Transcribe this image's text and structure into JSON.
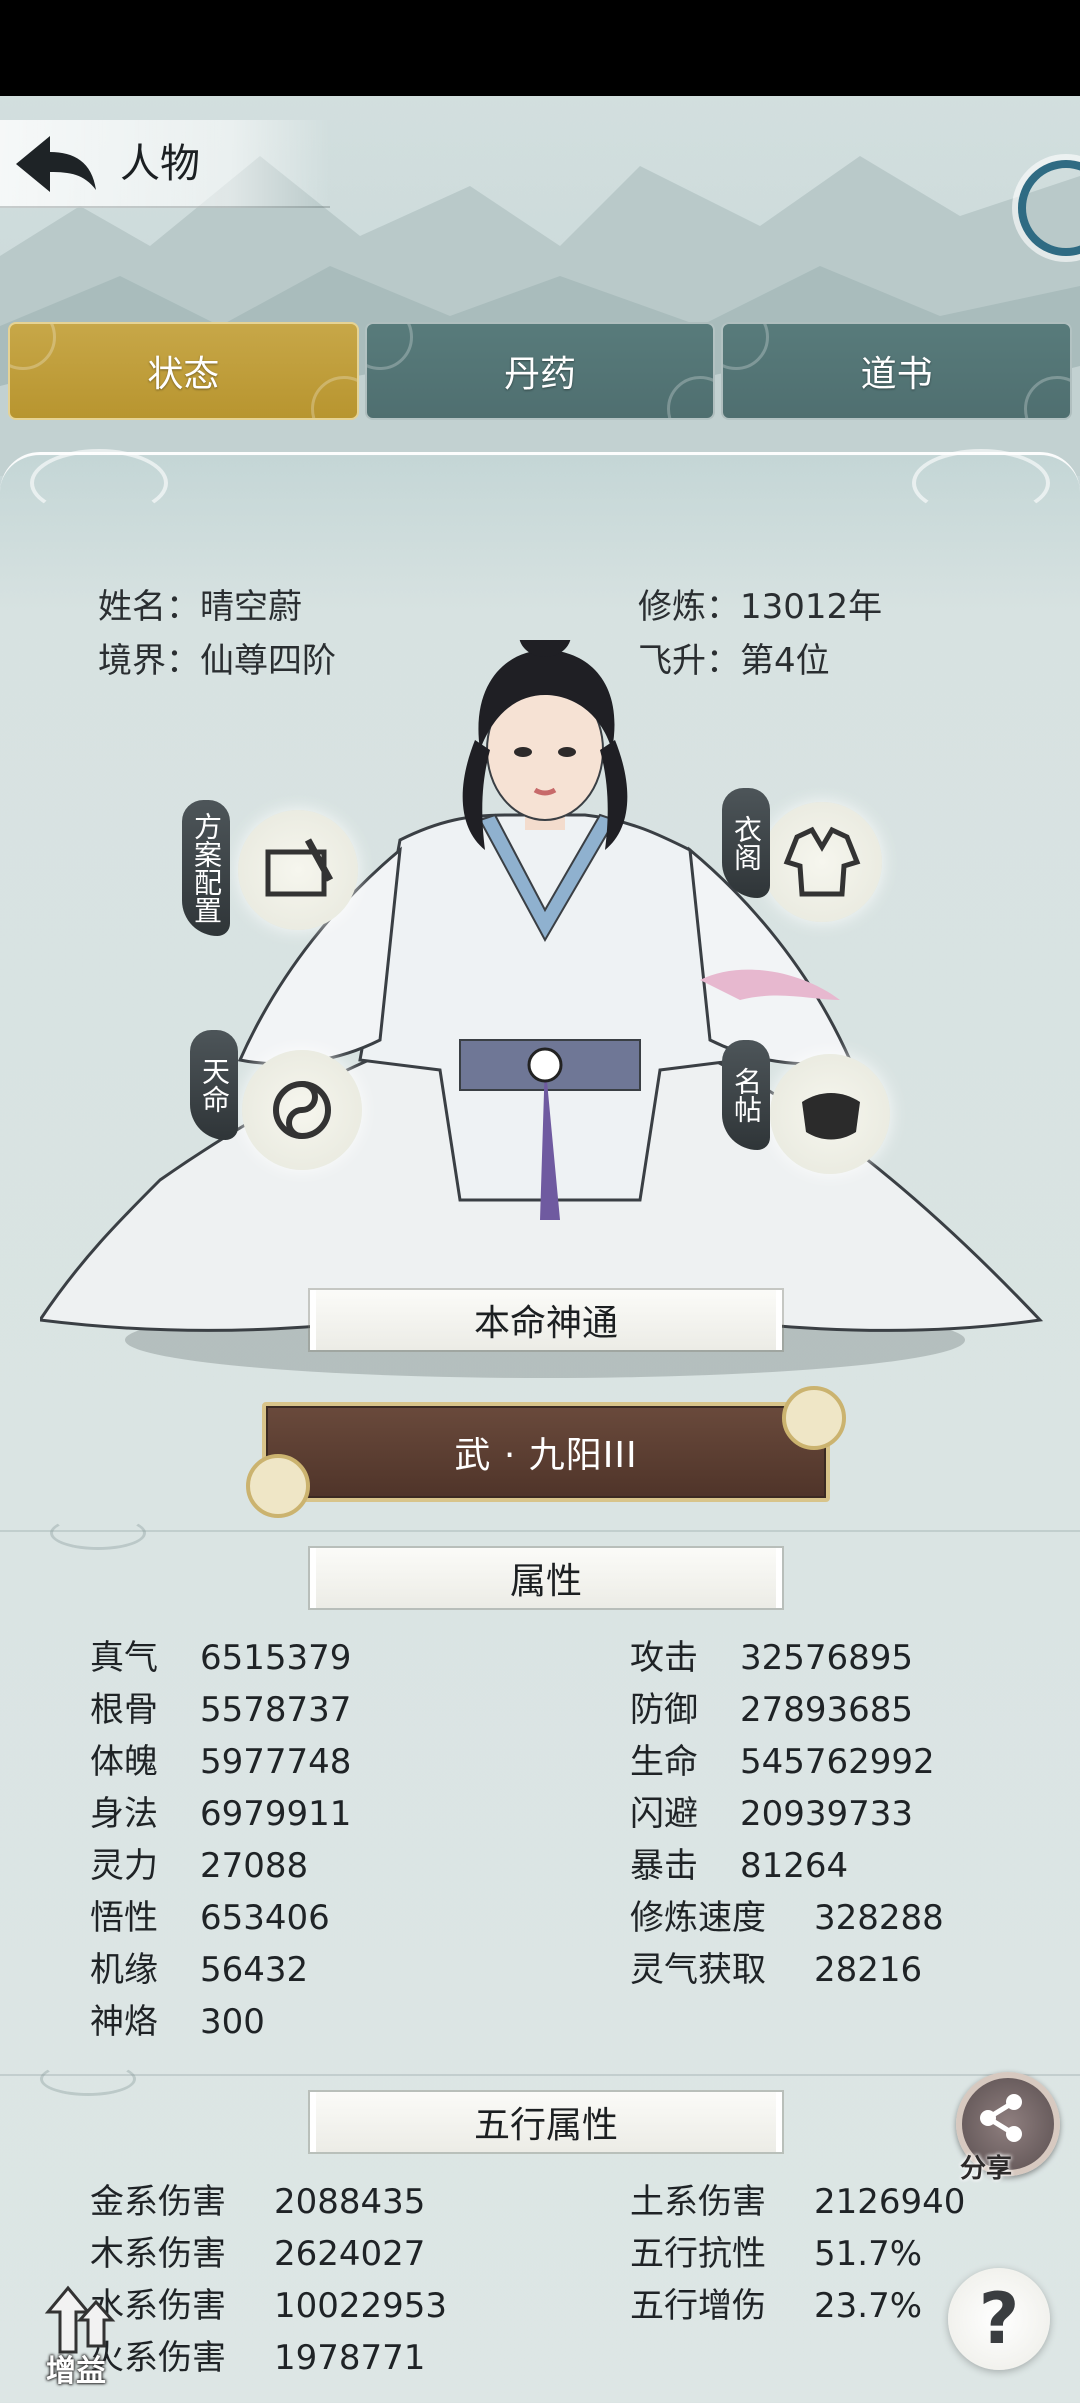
{
  "header": {
    "title": "人物"
  },
  "tabs": [
    {
      "label": "状态",
      "active": true
    },
    {
      "label": "丹药",
      "active": false
    },
    {
      "label": "道书",
      "active": false
    }
  ],
  "profile": {
    "name_label": "姓名：",
    "name": "晴空蔚",
    "realm_label": "境界：",
    "realm": "仙尊四阶",
    "cultivation_label": "修炼：",
    "cultivation": "13012年",
    "ascension_label": "飞升：",
    "ascension": "第4位"
  },
  "side_buttons": {
    "plan": "方案配置",
    "wardrobe": "衣阁",
    "fate": "天命",
    "card": "名帖"
  },
  "innate_skill": {
    "section_title": "本命神通",
    "name": "武 · 九阳III"
  },
  "attributes": {
    "section_title": "属性",
    "left": [
      {
        "label": "真气",
        "value": "6515379"
      },
      {
        "label": "根骨",
        "value": "5578737"
      },
      {
        "label": "体魄",
        "value": "5977748"
      },
      {
        "label": "身法",
        "value": "6979911"
      },
      {
        "label": "灵力",
        "value": "27088"
      },
      {
        "label": "悟性",
        "value": "653406"
      },
      {
        "label": "机缘",
        "value": "56432"
      },
      {
        "label": "神烙",
        "value": "300"
      }
    ],
    "right": [
      {
        "label": "攻击",
        "value": "32576895"
      },
      {
        "label": "防御",
        "value": "27893685"
      },
      {
        "label": "生命",
        "value": "545762992"
      },
      {
        "label": "闪避",
        "value": "20939733"
      },
      {
        "label": "暴击",
        "value": "81264"
      },
      {
        "label": "修炼速度",
        "value": "328288"
      },
      {
        "label": "灵气获取",
        "value": "28216"
      }
    ]
  },
  "elements": {
    "section_title": "五行属性",
    "left": [
      {
        "label": "金系伤害",
        "value": "2088435"
      },
      {
        "label": "木系伤害",
        "value": "2624027"
      },
      {
        "label": "水系伤害",
        "value": "10022953"
      },
      {
        "label": "火系伤害",
        "value": "1978771"
      }
    ],
    "right": [
      {
        "label": "土系伤害",
        "value": "2126940"
      },
      {
        "label": "五行抗性",
        "value": "51.7%"
      },
      {
        "label": "五行增伤",
        "value": "23.7%"
      }
    ]
  },
  "floating": {
    "share": "分享",
    "help": "?",
    "buff": "增益"
  },
  "colors": {
    "active_tab": "#c2a03f",
    "tab": "#557676",
    "skill_button": "#5e4033"
  }
}
